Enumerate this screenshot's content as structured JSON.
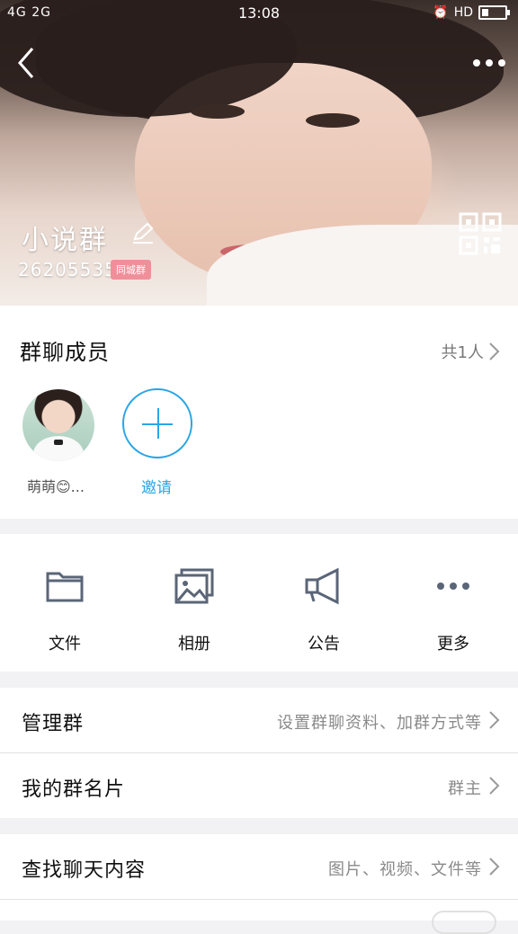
{
  "status_bar": {
    "left": "4G 2G",
    "time": "13:08",
    "right": "HD"
  },
  "header": {
    "group_name": "小说群",
    "group_id": "262055355",
    "badge": "同城群"
  },
  "members": {
    "title": "群聊成员",
    "count": "共1人",
    "list": [
      {
        "name": "萌萌😊..."
      }
    ],
    "invite_label": "邀请"
  },
  "tools": [
    {
      "label": "文件",
      "icon": "folder-icon"
    },
    {
      "label": "相册",
      "icon": "album-icon"
    },
    {
      "label": "公告",
      "icon": "megaphone-icon"
    },
    {
      "label": "更多",
      "icon": "more-icon"
    }
  ],
  "rows": {
    "manage": {
      "label": "管理群",
      "value": "设置群聊资料、加群方式等"
    },
    "card": {
      "label": "我的群名片",
      "value": "群主"
    },
    "search": {
      "label": "查找聊天内容",
      "value": "图片、视频、文件等"
    }
  },
  "colors": {
    "accent": "#29a6e6",
    "badge": "#f08f99"
  }
}
